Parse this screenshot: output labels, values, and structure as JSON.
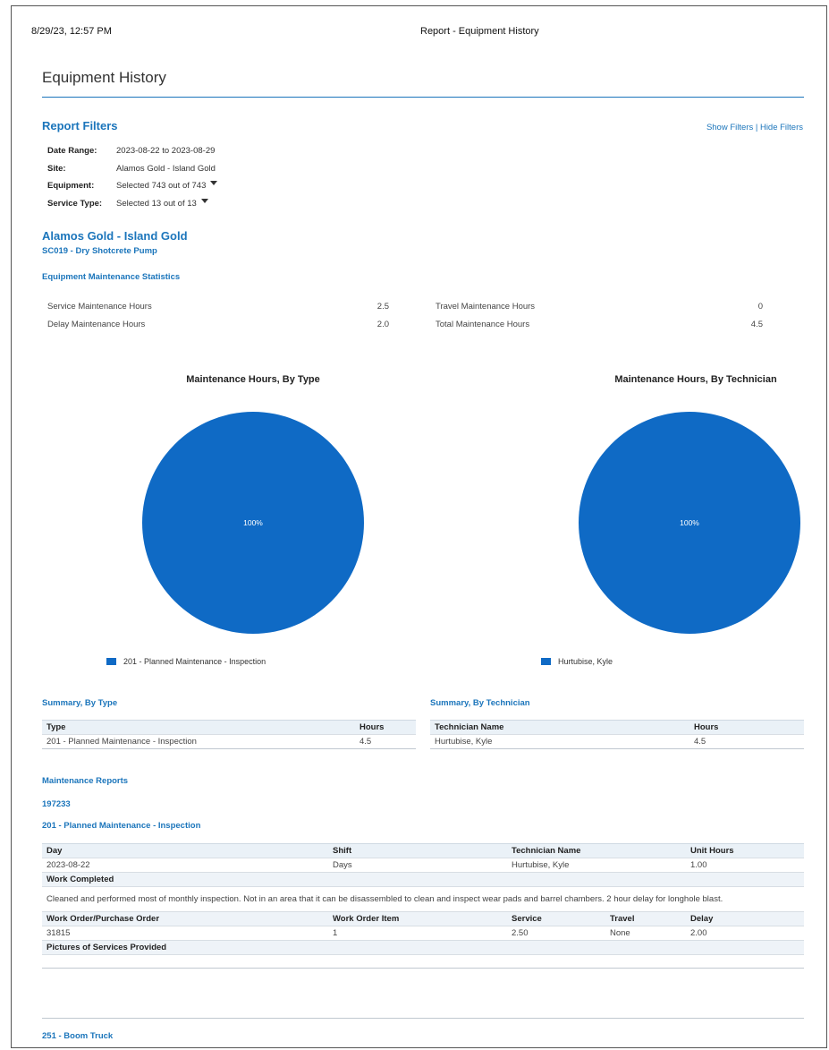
{
  "print_header": {
    "datetime": "8/29/23, 12:57 PM",
    "title": "Report - Equipment History"
  },
  "report_title": "Equipment History",
  "filters": {
    "heading": "Report Filters",
    "show_link": "Show Filters",
    "separator": "|",
    "hide_link": "Hide Filters",
    "rows": [
      {
        "label": "Date Range:",
        "value": "2023-08-22 to 2023-08-29"
      },
      {
        "label": "Site:",
        "value": "Alamos Gold - Island Gold"
      },
      {
        "label": "Equipment:",
        "value": "Selected 743 out of 743"
      },
      {
        "label": "Service Type:",
        "value": "Selected 13 out of 13"
      }
    ]
  },
  "site_name": "Alamos Gold - Island Gold",
  "equipment_name": "SC019 - Dry Shotcrete Pump",
  "stats": {
    "heading": "Equipment Maintenance Statistics",
    "service_label": "Service Maintenance Hours",
    "service_value": "2.5",
    "delay_label": "Delay Maintenance Hours",
    "delay_value": "2.0",
    "travel_label": "Travel Maintenance Hours",
    "travel_value": "0",
    "total_label": "Total Maintenance Hours",
    "total_value": "4.5"
  },
  "chart_data": [
    {
      "type": "pie",
      "title": "Maintenance Hours, By Type",
      "labels": [
        "201 - Planned Maintenance - Inspection"
      ],
      "values": [
        100
      ],
      "slice_labels": [
        "100%"
      ],
      "colors": [
        "#0f6ac5"
      ],
      "legend": "bottom"
    },
    {
      "type": "pie",
      "title": "Maintenance Hours, By Technician",
      "labels": [
        "Hurtubise, Kyle"
      ],
      "values": [
        100
      ],
      "slice_labels": [
        "100%"
      ],
      "colors": [
        "#0f6ac5"
      ],
      "legend": "bottom"
    }
  ],
  "summary_type": {
    "heading": "Summary, By Type",
    "col_type": "Type",
    "col_hours": "Hours",
    "row_type": "201 - Planned Maintenance - Inspection",
    "row_hours": "4.5"
  },
  "summary_tech": {
    "heading": "Summary, By Technician",
    "col_name": "Technician Name",
    "col_hours": "Hours",
    "row_name": "Hurtubise, Kyle",
    "row_hours": "4.5"
  },
  "maintenance": {
    "heading": "Maintenance Reports",
    "report_id": "197233",
    "service_type": "201 - Planned Maintenance - Inspection",
    "col_day": "Day",
    "col_shift": "Shift",
    "col_tech": "Technician Name",
    "col_unit": "Unit Hours",
    "day": "2023-08-22",
    "shift": "Days",
    "tech": "Hurtubise, Kyle",
    "unit_hours": "1.00",
    "work_completed_label": "Work Completed",
    "work_completed_text": "Cleaned and performed most of monthly inspection. Not in an area that it can be disassembled to clean and inspect wear pads and barrel chambers. 2 hour delay for longhole blast.",
    "col_wo": "Work Order/Purchase Order",
    "col_wo_item": "Work Order Item",
    "col_service": "Service",
    "col_travel": "Travel",
    "col_delay": "Delay",
    "wo": "31815",
    "wo_item": "1",
    "service": "2.50",
    "travel": "None",
    "delay": "2.00",
    "pictures_label": "Pictures of Services Provided"
  },
  "next_equipment": "251 - Boom Truck",
  "colors": {
    "accent": "#1b75bb",
    "pie": "#0f6ac5",
    "header_bg": "#eaf1f7"
  }
}
